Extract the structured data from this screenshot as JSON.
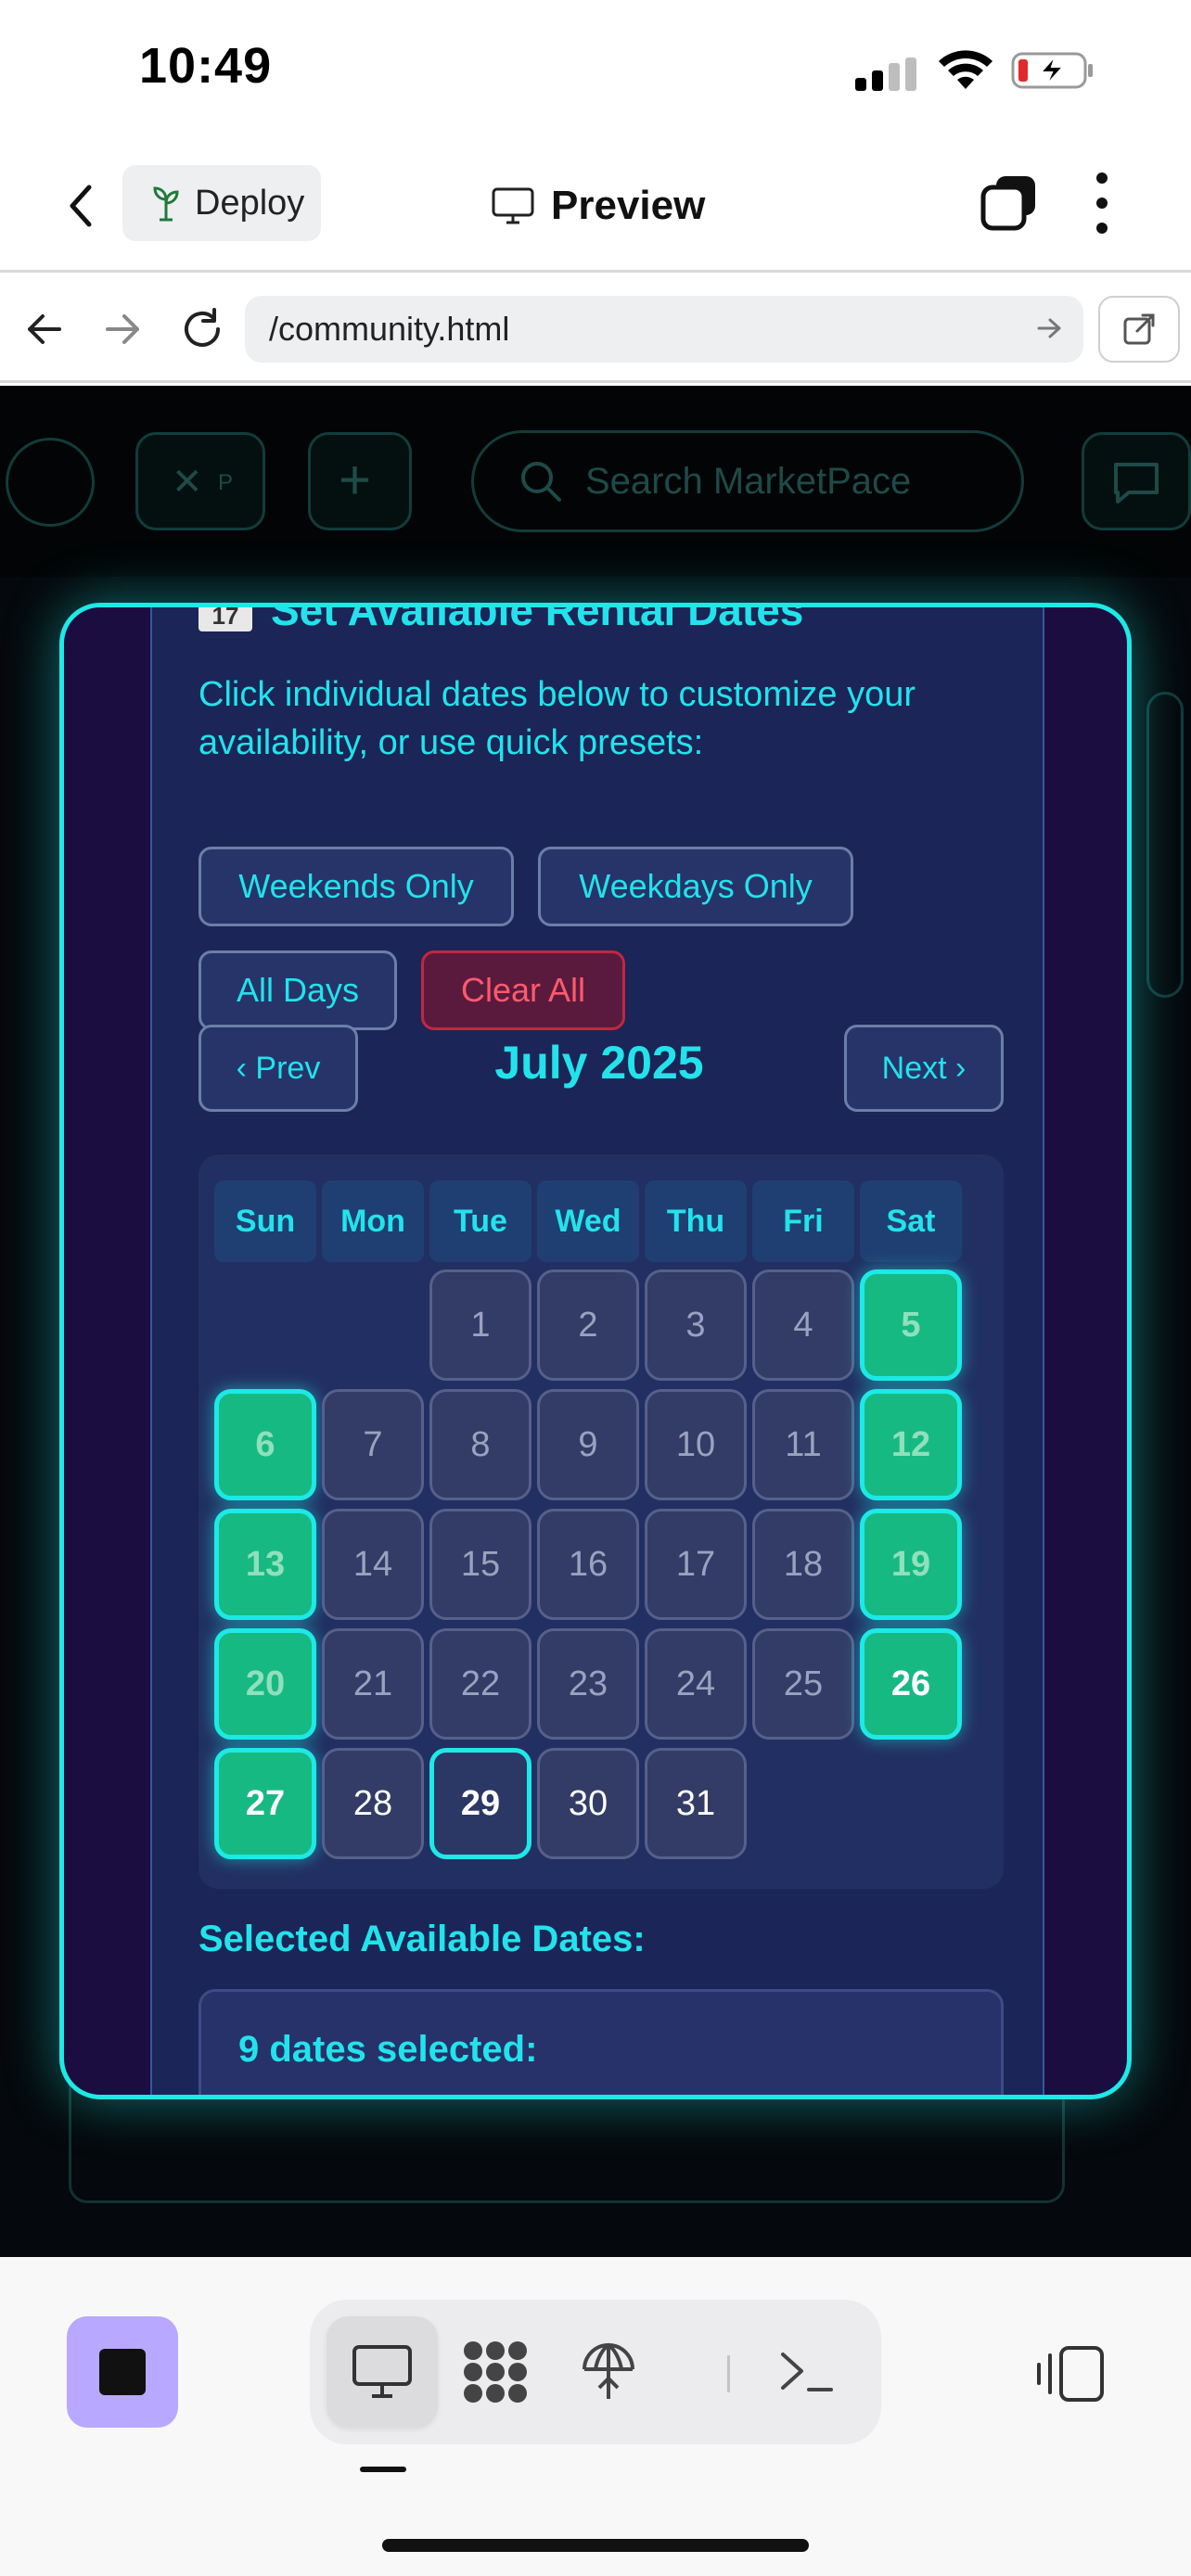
{
  "status_bar": {
    "time": "10:49"
  },
  "app_bar": {
    "deploy_label": "Deploy",
    "preview_label": "Preview"
  },
  "browser": {
    "url": "/community.html"
  },
  "site_header": {
    "search_placeholder": "Search MarketPace",
    "badge_letter": "P"
  },
  "modal": {
    "section_title": "Set Available Rental Dates",
    "calendar_emoji_text": "17",
    "instructions": "Click individual dates below to customize your availability, or use quick presets:",
    "presets": {
      "weekends": "Weekends Only",
      "weekdays": "Weekdays Only",
      "all_days": "All Days",
      "clear_all": "Clear All"
    },
    "nav": {
      "prev": "‹ Prev",
      "next": "Next ›",
      "month": "July 2025"
    },
    "weekdays": [
      "Sun",
      "Mon",
      "Tue",
      "Wed",
      "Thu",
      "Fri",
      "Sat"
    ],
    "first_weekday_index": 2,
    "days_in_month": 31,
    "selected_days": [
      5,
      6,
      12,
      13,
      19,
      20,
      26,
      27
    ],
    "today": 29,
    "selected_heading": "Selected Available Dates:",
    "selected_count_text": "9 dates selected:"
  },
  "colors": {
    "accent_cyan": "#1de9e6",
    "selected_green": "#17b982",
    "danger_red": "#ff5a6a",
    "stop_button_purple": "#b9a8ff"
  },
  "icons": {
    "deploy": "sprout-icon",
    "preview": "monitor-icon",
    "tabs": "tabs-icon",
    "more": "vertical-dots-icon",
    "back": "chevron-left-icon",
    "forward": "arrow-right-icon",
    "reload": "reload-icon",
    "open_external": "external-link-icon",
    "toolbar": [
      "monitor-icon",
      "bento-icon",
      "deploy-icon",
      "terminal-icon",
      "layout-toggle-icon"
    ]
  }
}
